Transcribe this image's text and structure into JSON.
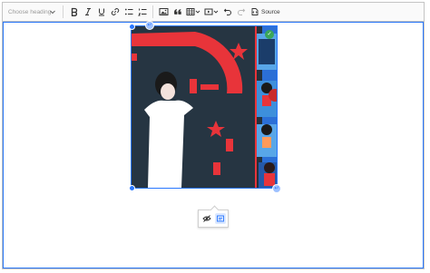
{
  "toolbar": {
    "heading_placeholder": "Choose heading",
    "source_label": "Source"
  },
  "colors": {
    "accent": "#2977ff",
    "toolbar_bg": "#fafafa",
    "icon": "#333333",
    "icon_disabled": "#b7b7b7"
  },
  "image": {
    "subject": "stylized-illustration",
    "alt": ""
  },
  "icons": [
    "bold-icon",
    "italic-icon",
    "underline-icon",
    "link-icon",
    "bulleted-list-icon",
    "numbered-list-icon",
    "image-icon",
    "blockquote-icon",
    "table-icon",
    "media-embed-icon",
    "undo-icon",
    "redo-icon",
    "source-icon",
    "toggle-caption-icon",
    "alt-text-icon"
  ]
}
